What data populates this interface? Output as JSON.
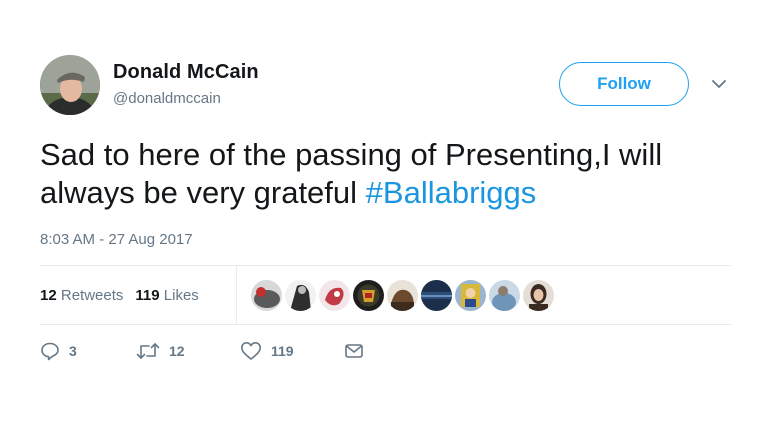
{
  "user": {
    "display_name": "Donald McCain",
    "handle": "@donaldmccain"
  },
  "follow_button": {
    "label": "Follow"
  },
  "tweet": {
    "text_line1": "Sad to here of the passing of Presenting,I will",
    "text_line2_prefix": "always be very grateful ",
    "hashtag": "#Ballabriggs",
    "timestamp": "8:03 AM - 27 Aug 2017"
  },
  "stats": {
    "retweets_count": "12",
    "retweets_label": "Retweets",
    "likes_count": "119",
    "likes_label": "Likes"
  },
  "likers": [
    {
      "icon": "liker-avatar-1",
      "color": "#5a5a5a"
    },
    {
      "icon": "liker-avatar-2",
      "color": "#2e2e2e"
    },
    {
      "icon": "liker-avatar-3",
      "color": "#c23a46"
    },
    {
      "icon": "liker-avatar-4",
      "color": "#3b3a2a"
    },
    {
      "icon": "liker-avatar-5",
      "color": "#6b4a2e"
    },
    {
      "icon": "liker-avatar-6",
      "color": "#2b4e7a"
    },
    {
      "icon": "liker-avatar-7",
      "color": "#d8b83a"
    },
    {
      "icon": "liker-avatar-8",
      "color": "#6f95b8"
    },
    {
      "icon": "liker-avatar-9",
      "color": "#3a2a22"
    }
  ],
  "actions": {
    "reply_count": "3",
    "retweet_count": "12",
    "like_count": "119"
  },
  "colors": {
    "accent": "#1da1f2",
    "hashtag": "#1b95e0",
    "muted": "#657786",
    "text": "#14171a"
  }
}
